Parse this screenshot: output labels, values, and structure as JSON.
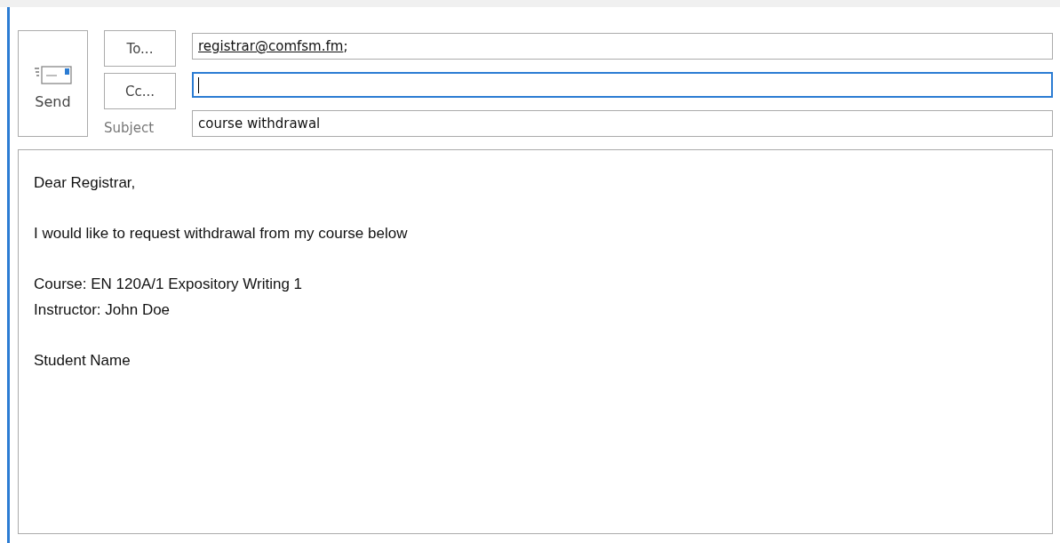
{
  "send_button": {
    "label": "Send"
  },
  "address_buttons": [
    {
      "label": "To..."
    },
    {
      "label": "Cc..."
    }
  ],
  "fields": [
    {
      "kind": "recipients",
      "focused": false,
      "recipients": [
        {
          "address": "registrar@comfsm.fm",
          "separator": ";"
        }
      ]
    },
    {
      "kind": "recipients",
      "focused": true
    },
    {
      "kind": "text",
      "label": "Subject",
      "focused": false,
      "value": "course withdrawal"
    }
  ],
  "body": {
    "paragraphs": [
      [
        "Dear Registrar,"
      ],
      [
        "I would like to request withdrawal from my course below"
      ],
      [
        "Course: EN 120A/1 Expository Writing 1",
        "Instructor: John Doe"
      ],
      [
        "Student Name"
      ]
    ]
  }
}
